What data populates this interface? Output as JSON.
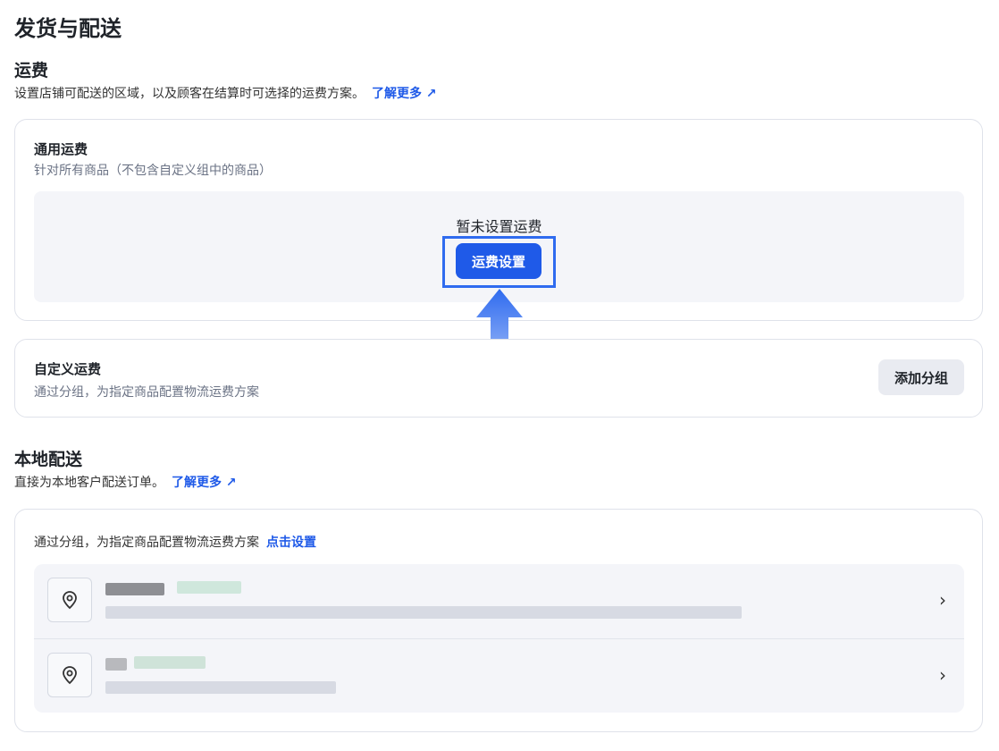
{
  "page_title": "发货与配送",
  "shipping": {
    "title": "运费",
    "description": "设置店铺可配送的区域，以及顾客在结算时可选择的运费方案。",
    "learn_more": "了解更多 ↗",
    "general": {
      "title": "通用运费",
      "description": "针对所有商品（不包含自定义组中的商品）",
      "empty_text": "暂未设置运费",
      "setup_button": "运费设置"
    },
    "custom": {
      "title": "自定义运费",
      "description": "通过分组，为指定商品配置物流运费方案",
      "add_button": "添加分组"
    }
  },
  "local": {
    "title": "本地配送",
    "description": "直接为本地客户配送订单。",
    "learn_more": "了解更多 ↗",
    "card_text": "通过分组，为指定商品配置物流运费方案",
    "card_link": "点击设置",
    "items": [
      {
        "chevron": "›"
      },
      {
        "chevron": "›"
      }
    ]
  },
  "colors": {
    "accent": "#1f5ae8"
  }
}
